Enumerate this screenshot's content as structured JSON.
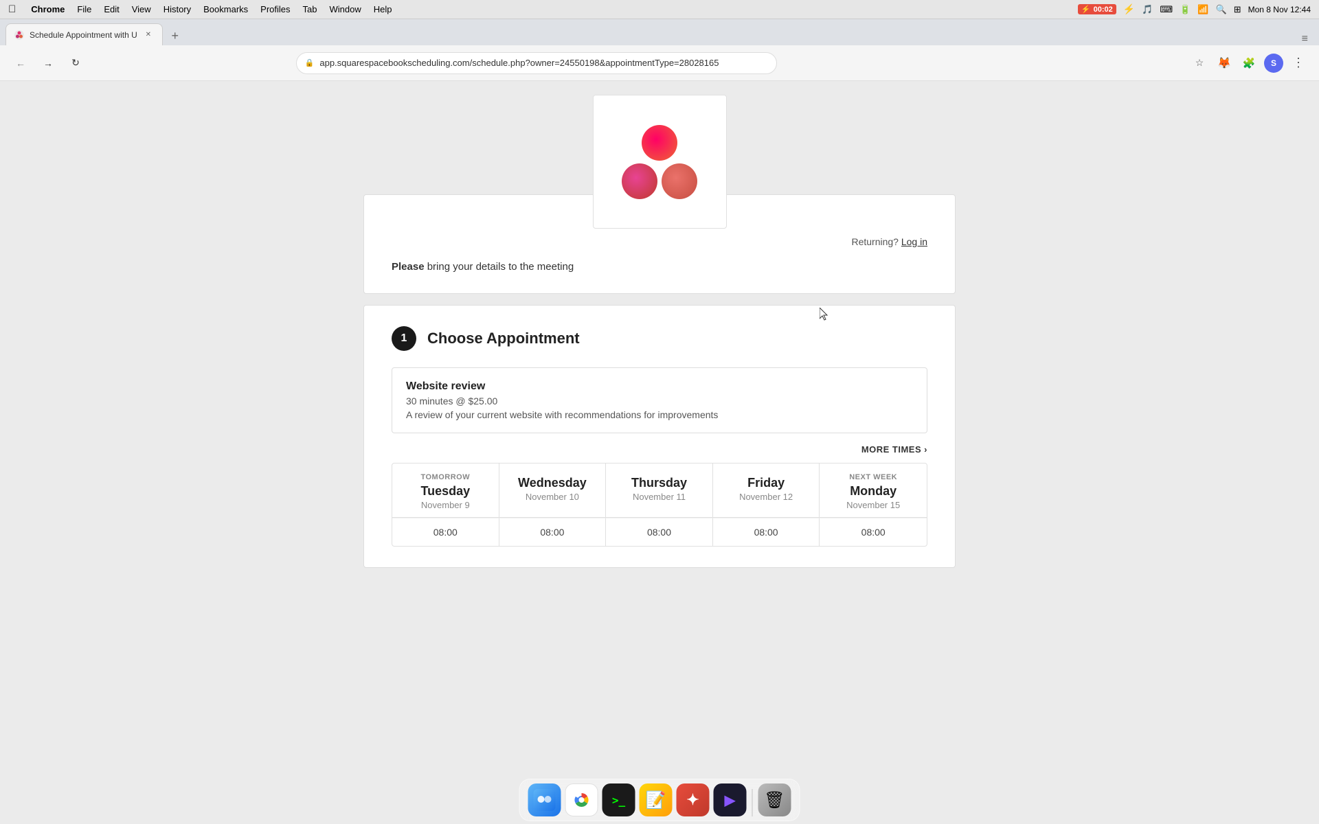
{
  "menubar": {
    "apple": "⌘",
    "items": [
      "Chrome",
      "File",
      "Edit",
      "View",
      "History",
      "Bookmarks",
      "Profiles",
      "Tab",
      "Window",
      "Help"
    ],
    "chrome_bold": "Chrome",
    "time": "Mon 8 Nov  12:44",
    "battery_time": "00:02"
  },
  "browser": {
    "tab_title": "Schedule Appointment with U",
    "url": "app.squarespacebookscheduling.com/schedule.php?owner=24550198&appointmentType=28028165",
    "url_display": "app.squarespacebookscheduling.com/schedule.php?owner=24550198&appointmentType=28028165"
  },
  "page": {
    "returning_text": "Returning?",
    "login_link": "Log in",
    "please_text": "Please",
    "please_rest": " bring your details to the meeting",
    "step_number": "1",
    "step_title": "Choose Appointment",
    "appointment": {
      "name": "Website review",
      "meta": "30 minutes @ $25.00",
      "description": "A review of your current website with recommendations for improvements"
    },
    "more_times": "MORE TIMES",
    "calendar": {
      "days": [
        {
          "label": "TOMORROW",
          "name": "Tuesday",
          "date": "November 9"
        },
        {
          "label": "",
          "name": "Wednesday",
          "date": "November 10"
        },
        {
          "label": "",
          "name": "Thursday",
          "date": "November 11"
        },
        {
          "label": "",
          "name": "Friday",
          "date": "November 12"
        },
        {
          "label": "NEXT WEEK",
          "name": "Monday",
          "date": "November 15"
        }
      ],
      "times": [
        "08:00",
        "08:00",
        "08:00",
        "08:00",
        "08:00"
      ]
    }
  },
  "dock": {
    "icons": [
      {
        "name": "finder",
        "emoji": "🔵",
        "class": "dock-finder"
      },
      {
        "name": "chrome",
        "emoji": "🌐",
        "class": "dock-chrome"
      },
      {
        "name": "terminal",
        "emoji": "⬛",
        "class": "dock-terminal"
      },
      {
        "name": "notes",
        "emoji": "📝",
        "class": "dock-notes"
      },
      {
        "name": "cursor-app",
        "emoji": "🖱",
        "class": "dock-cursor-app"
      },
      {
        "name": "warp",
        "emoji": "▶",
        "class": "dock-warp"
      },
      {
        "name": "trash",
        "emoji": "🗑",
        "class": "dock-trash"
      }
    ]
  }
}
